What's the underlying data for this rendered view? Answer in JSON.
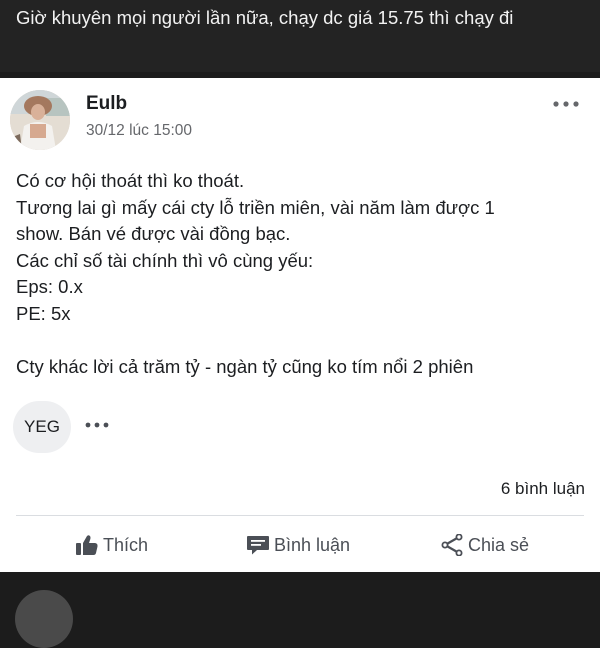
{
  "previous_post": {
    "text": "Giờ khuyên mọi người lần nữa, chạy dc giá 15.75 thì chạy đi"
  },
  "post": {
    "author": "Eulb",
    "timestamp": "30/12 lúc 15:00",
    "body_lines": [
      "Có cơ hội thoát thì ko thoát.",
      "Tương lai gì mấy cái cty lỗ triền miên, vài năm làm được 1",
      "show. Bán vé được vài đồng bạc.",
      "Các chỉ số tài chính thì vô cùng yếu:",
      "Eps: 0.x",
      "PE: 5x",
      "",
      "Cty khác lời cả trăm tỷ - ngàn tỷ cũng ko tím nổi 2 phiên"
    ],
    "tag": "YEG",
    "comment_count": "6 bình luận",
    "actions": {
      "like": "Thích",
      "comment": "Bình luận",
      "share": "Chia sẻ"
    }
  },
  "icons": {
    "more": "more-horizontal-icon",
    "like": "thumbs-up-icon",
    "comment": "comment-bubble-icon",
    "share": "share-icon"
  },
  "colors": {
    "text": "#1c1e21",
    "secondary_text": "#65676b",
    "action_text": "#4b4f56",
    "card_background": "#ffffff",
    "page_background": "#1c1c1c"
  }
}
